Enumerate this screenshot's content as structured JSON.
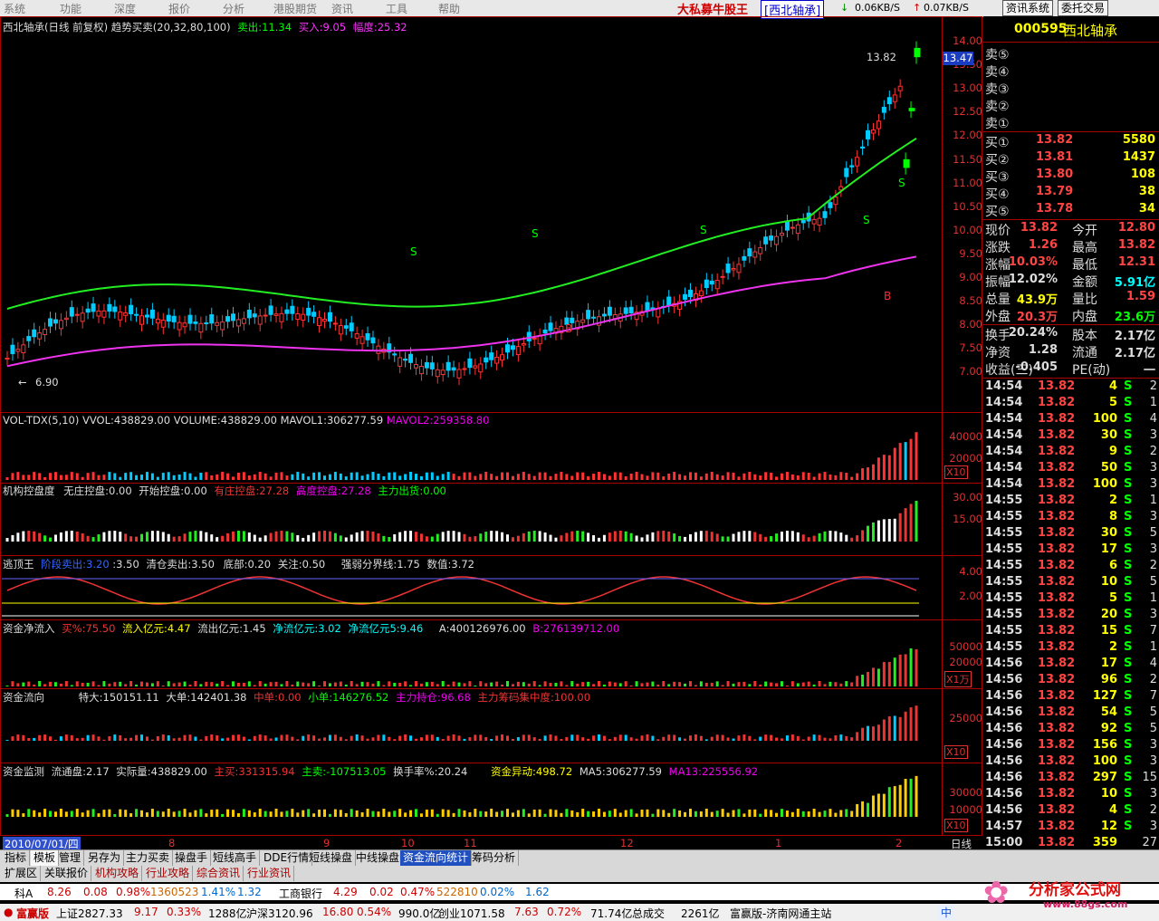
{
  "menu": {
    "items": [
      "系统",
      "功能",
      "深度",
      "报价",
      "分析",
      "港股期货",
      "资讯",
      "工具",
      "帮助"
    ],
    "title": "大私募牛股王",
    "stock_tag": "[西北轴承]",
    "speed_down": "0.06KB/S",
    "speed_up": "0.07KB/S",
    "buttons": [
      "资讯系统",
      "委托交易"
    ]
  },
  "main_panel": {
    "title": "西北轴承(日线 前复权) 趋势买卖(20,32,80,100)",
    "sell": "卖出:11.34",
    "buy": "买入:9.05",
    "amplitude": "幅度:25.32",
    "price_labels": [
      "14.00",
      "13.50",
      "13.00",
      "12.50",
      "12.00",
      "11.50",
      "11.00",
      "10.50",
      "10.00",
      "9.50",
      "9.00",
      "8.50",
      "8.00",
      "7.50",
      "7.00"
    ],
    "current_price_tag": "13.47",
    "high_marker": "13.82",
    "low_marker": "6.90",
    "marker_s": "S",
    "marker_b": "B"
  },
  "vol_panel": {
    "labels": [
      "VOL-TDX(5,10)",
      "VVOL:438829.00",
      "VOLUME:438829.00",
      "MAVOL1:306277.59",
      "MAVOL2:259358.80"
    ],
    "y": [
      "40000",
      "20000"
    ],
    "unit": "X10"
  },
  "inst_panel": {
    "labels": [
      "机构控盘度",
      "无庄控盘:0.00",
      "开始控盘:0.00",
      "有庄控盘:27.28",
      "高度控盘:27.28",
      "主力出货:0.00"
    ],
    "y": [
      "30.00",
      "15.00"
    ]
  },
  "escape_panel": {
    "labels": [
      "逃顶王",
      "阶段卖出:3.20",
      ":3.50",
      "清仓卖出:3.50",
      "底部:0.20",
      "关注:0.50",
      "强弱分界线:1.75",
      "数值:3.72"
    ],
    "y": [
      "4.00",
      "2.00"
    ]
  },
  "netflow_panel": {
    "labels": [
      "资金净流入",
      "买%:75.50",
      "流入亿元:4.47",
      "流出亿元:1.45",
      "净流亿元:3.02",
      "净流亿元5:9.46",
      "A:400126976.00",
      "B:276139712.00"
    ],
    "y": [
      "50000",
      "20000"
    ],
    "unit": "X1万"
  },
  "flow_panel": {
    "labels": [
      "资金流向",
      "特大:150151.11",
      "大单:142401.38",
      "中单:0.00",
      "小单:146276.52",
      "主力持仓:96.68",
      "主力筹码集中度:100.00"
    ],
    "y": [
      "25000"
    ],
    "unit": "X10"
  },
  "monitor_panel": {
    "labels": [
      "资金监测",
      "流通盘:2.17",
      "实际量:438829.00",
      "主买:331315.94",
      "主卖:-107513.05",
      "换手率%:20.24",
      "资金异动:498.72",
      "MA5:306277.59",
      "MA13:225556.92"
    ],
    "y": [
      "30000",
      "10000"
    ],
    "unit": "X10"
  },
  "x_axis": {
    "date_label": "2010/07/01/四",
    "months": [
      "2",
      "8",
      "9",
      "10",
      "11",
      "12",
      "1",
      "2"
    ],
    "period": "日线"
  },
  "quote": {
    "code": "000595",
    "name": "西北轴承",
    "sells": [
      "卖⑤",
      "卖④",
      "卖③",
      "卖②",
      "卖①"
    ],
    "buys": [
      {
        "label": "买①",
        "price": "13.82",
        "vol": "5580"
      },
      {
        "label": "买②",
        "price": "13.81",
        "vol": "1437"
      },
      {
        "label": "买③",
        "price": "13.80",
        "vol": "108"
      },
      {
        "label": "买④",
        "price": "13.79",
        "vol": "38"
      },
      {
        "label": "买⑤",
        "price": "13.78",
        "vol": "34"
      }
    ],
    "stats": [
      {
        "l1": "现价",
        "v1": "13.82",
        "l2": "今开",
        "v2": "12.80"
      },
      {
        "l1": "涨跌",
        "v1": "1.26",
        "l2": "最高",
        "v2": "13.82"
      },
      {
        "l1": "涨幅",
        "v1": "10.03%",
        "l2": "最低",
        "v2": "12.31"
      },
      {
        "l1": "振幅",
        "v1": "12.02%",
        "l2": "金额",
        "v2": "5.91亿"
      },
      {
        "l1": "总量",
        "v1": "43.9万",
        "l2": "量比",
        "v2": "1.59"
      },
      {
        "l1": "外盘",
        "v1": "20.3万",
        "l2": "内盘",
        "v2": "23.6万"
      },
      {
        "l1": "换手",
        "v1": "20.24%",
        "l2": "股本",
        "v2": "2.17亿"
      },
      {
        "l1": "净资",
        "v1": "1.28",
        "l2": "流通",
        "v2": "2.17亿"
      },
      {
        "l1": "收益(三)",
        "v1": "-0.405",
        "l2": "PE(动)",
        "v2": "一"
      }
    ],
    "ticks": [
      [
        "14:54",
        "13.82",
        "4",
        "S",
        "2"
      ],
      [
        "14:54",
        "13.82",
        "5",
        "S",
        "1"
      ],
      [
        "14:54",
        "13.82",
        "100",
        "S",
        "4"
      ],
      [
        "14:54",
        "13.82",
        "30",
        "S",
        "3"
      ],
      [
        "14:54",
        "13.82",
        "9",
        "S",
        "2"
      ],
      [
        "14:54",
        "13.82",
        "50",
        "S",
        "3"
      ],
      [
        "14:54",
        "13.82",
        "100",
        "S",
        "3"
      ],
      [
        "14:55",
        "13.82",
        "2",
        "S",
        "1"
      ],
      [
        "14:55",
        "13.82",
        "8",
        "S",
        "3"
      ],
      [
        "14:55",
        "13.82",
        "30",
        "S",
        "5"
      ],
      [
        "14:55",
        "13.82",
        "17",
        "S",
        "3"
      ],
      [
        "14:55",
        "13.82",
        "6",
        "S",
        "2"
      ],
      [
        "14:55",
        "13.82",
        "10",
        "S",
        "5"
      ],
      [
        "14:55",
        "13.82",
        "5",
        "S",
        "1"
      ],
      [
        "14:55",
        "13.82",
        "20",
        "S",
        "3"
      ],
      [
        "14:55",
        "13.82",
        "15",
        "S",
        "7"
      ],
      [
        "14:55",
        "13.82",
        "2",
        "S",
        "1"
      ],
      [
        "14:56",
        "13.82",
        "17",
        "S",
        "4"
      ],
      [
        "14:56",
        "13.82",
        "96",
        "S",
        "2"
      ],
      [
        "14:56",
        "13.82",
        "127",
        "S",
        "7"
      ],
      [
        "14:56",
        "13.82",
        "54",
        "S",
        "5"
      ],
      [
        "14:56",
        "13.82",
        "92",
        "S",
        "5"
      ],
      [
        "14:56",
        "13.82",
        "156",
        "S",
        "3"
      ],
      [
        "14:56",
        "13.82",
        "100",
        "S",
        "3"
      ],
      [
        "14:56",
        "13.82",
        "297",
        "S",
        "15"
      ],
      [
        "14:56",
        "13.82",
        "10",
        "S",
        "3"
      ],
      [
        "14:56",
        "13.82",
        "4",
        "S",
        "2"
      ],
      [
        "14:57",
        "13.82",
        "12",
        "S",
        "3"
      ],
      [
        "15:00",
        "13.82",
        "359",
        "",
        "27"
      ]
    ]
  },
  "tabs": [
    "指标",
    "模板",
    "管理",
    "另存为",
    "主力买卖",
    "操盘手",
    "短线高手",
    "DDE行情",
    "短线操盘",
    "中线操盘",
    "资金流向统计",
    "筹码分析"
  ],
  "tabs2": [
    "扩展区",
    "关联报价",
    "机构攻略",
    "行业攻略",
    "综合资讯",
    "行业资讯"
  ],
  "ticker1": {
    "name": "科A",
    "v1": "8.26",
    "v2": "0.08",
    "v3": "0.98%",
    "v4": "1360523",
    "v5": "1.41%",
    "v6": "1.32",
    "name2": "工商银行",
    "w1": "4.29",
    "w2": "0.02",
    "w3": "0.47%",
    "w4": "522810",
    "w5": "0.02%",
    "w6": "1.62"
  },
  "ticker2": {
    "brand": "富赢版",
    "sh": "上证2827.33",
    "sh2": "9.17",
    "sh3": "0.33%",
    "sh4": "1288亿",
    "hs": "沪深3120.96",
    "hs2": "16.80",
    "hs3": "0.54%",
    "hs4": "990.0亿",
    "cy": "创业1071.58",
    "cy2": "7.63",
    "cy3": "0.72%",
    "cy4": "71.74亿",
    "total": "总成交",
    "total2": "2261亿",
    "site": "富赢版-济南网通主站"
  },
  "watermark": {
    "brand": "分析家公式网",
    "url": "www.88gs.com",
    "ime": "中"
  }
}
